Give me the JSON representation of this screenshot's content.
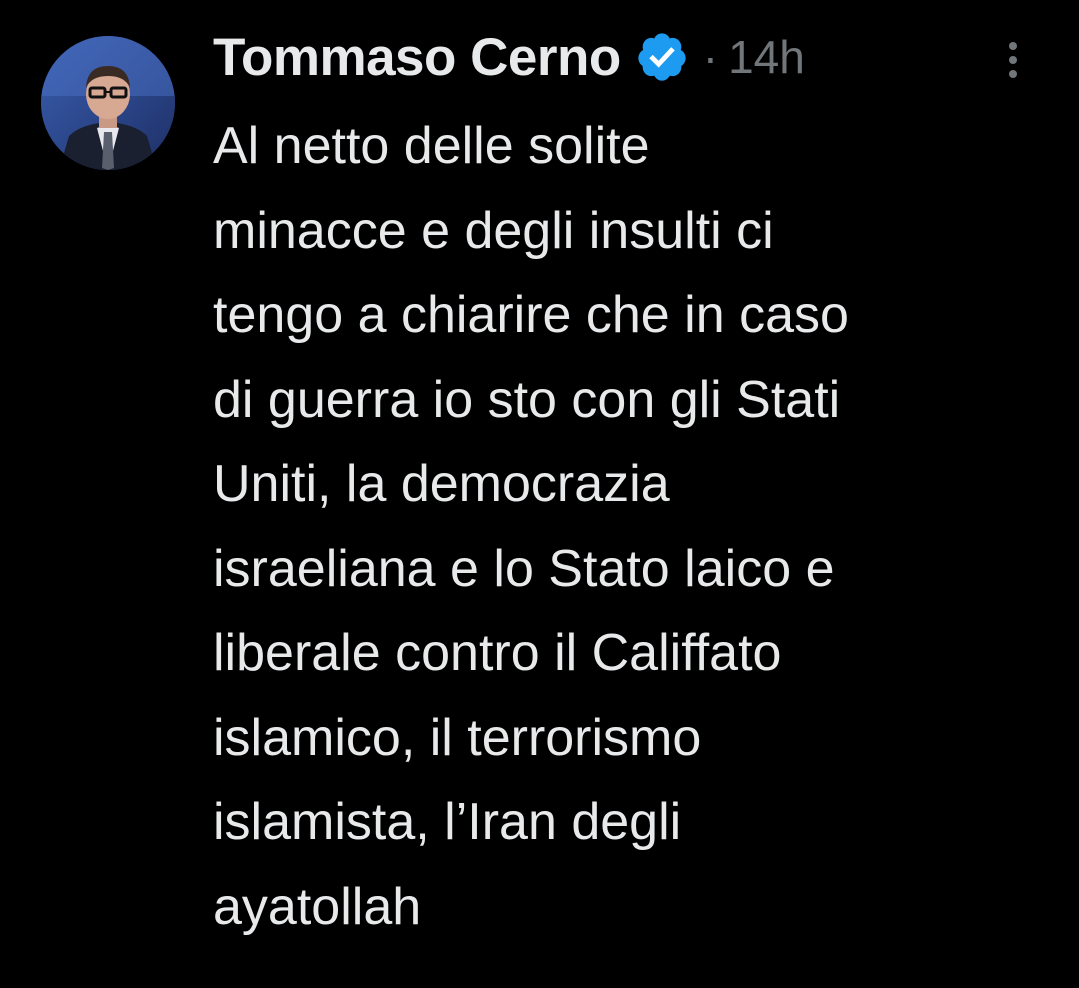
{
  "tweet": {
    "author": {
      "display_name": "Tommaso Cerno",
      "verified_icon": "verified-badge-icon",
      "avatar_icon": "profile-photo"
    },
    "separator": "·",
    "time": "14h",
    "more_icon": "more-vertical-icon",
    "text_lines": [
      "Al netto delle solite",
      "minacce e degli insulti ci",
      "tengo a chiarire che in caso",
      "di guerra io sto con gli Stati",
      "Uniti, la democrazia",
      "israeliana e lo Stato laico e",
      "liberale contro il Califfato",
      "islamico, il terrorismo",
      "islamista, l’Iran degli",
      "ayatollah"
    ]
  },
  "colors": {
    "background": "#000000",
    "text_primary": "#e7e9ea",
    "text_secondary": "#71767b",
    "verified_blue": "#1d9bf0"
  }
}
